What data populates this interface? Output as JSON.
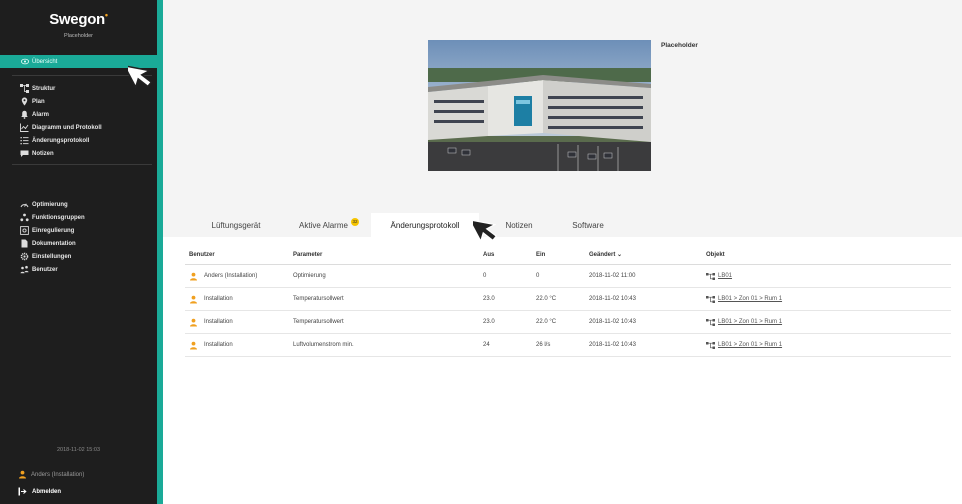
{
  "brand": {
    "name": "Swegon",
    "subtitle": "Placeholder"
  },
  "sidebar": {
    "active": "Übersicht",
    "group1": [
      "Struktur",
      "Plan",
      "Alarm",
      "Diagramm und Protokoll",
      "Änderungsprotokoll",
      "Notizen"
    ],
    "group2": [
      "Optimierung",
      "Funktionsgruppen",
      "Einregulierung",
      "Dokumentation",
      "Einstellungen",
      "Benutzer"
    ],
    "timestamp": "2018-11-02 15:03",
    "user": "Anders (Installation)",
    "logout": "Abmelden"
  },
  "hero": {
    "label": "Placeholder"
  },
  "tabs": {
    "t1": "Lüftungsgerät",
    "t2": "Aktive Alarme",
    "t2_badge": "32",
    "t3": "Änderungsprotokoll",
    "t4": "Notizen",
    "t5": "Software"
  },
  "table": {
    "headers": {
      "user": "Benutzer",
      "param": "Parameter",
      "aus": "Aus",
      "ein": "Ein",
      "date": "Geändert ⌄",
      "obj": "Objekt"
    },
    "rows": [
      {
        "user": "Anders (Installation)",
        "param": "Optimierung",
        "aus": "0",
        "ein": "0",
        "date": "2018-11-02 11:00",
        "obj": "LB01"
      },
      {
        "user": "Installation",
        "param": "Temperatursollwert",
        "aus": "23.0",
        "ein": "22.0 °C",
        "date": "2018-11-02 10:43",
        "obj": "LB01 > Zon 01 > Rum 1"
      },
      {
        "user": "Installation",
        "param": "Temperatursollwert",
        "aus": "23.0",
        "ein": "22.0 °C",
        "date": "2018-11-02 10:43",
        "obj": "LB01 > Zon 01 > Rum 1"
      },
      {
        "user": "Installation",
        "param": "Luftvolumenstrom min.",
        "aus": "24",
        "ein": "26 l/s",
        "date": "2018-11-02 10:43",
        "obj": "LB01 > Zon 01 > Rum 1"
      }
    ]
  },
  "colors": {
    "accent": "#1aaa98",
    "sidebar": "#1e1e1e",
    "badge": "#f5c400",
    "user_icon": "#f0a020"
  },
  "icons": [
    "eye-icon",
    "structure-icon",
    "location-pin-icon",
    "bell-icon",
    "chart-icon",
    "list-icon",
    "note-icon",
    "gauge-icon",
    "group-icon",
    "balance-icon",
    "document-icon",
    "gear-icon",
    "users-icon",
    "user-icon",
    "logout-icon",
    "object-tree-icon"
  ]
}
